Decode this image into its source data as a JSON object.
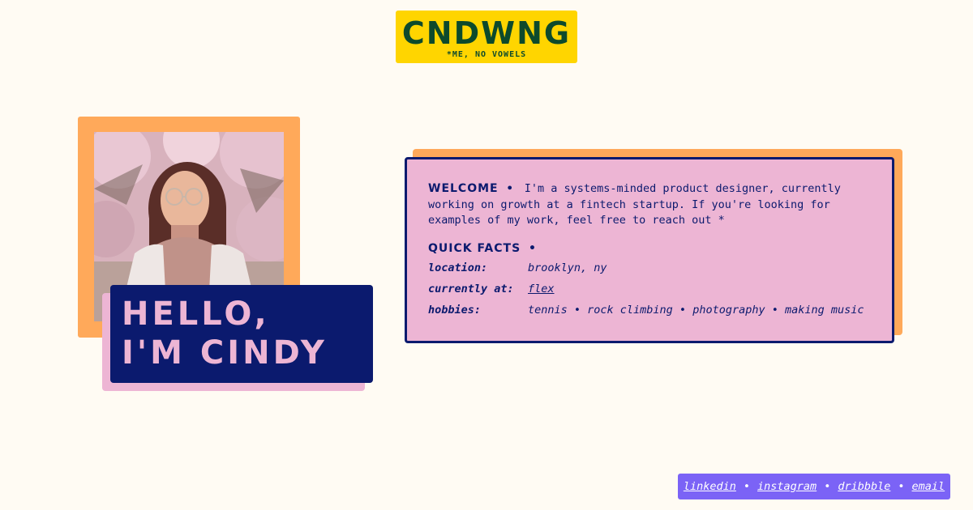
{
  "logo": {
    "title": "CNDWNG",
    "subtitle": "*ME, NO VOWELS"
  },
  "hero": {
    "line1": "HELLO,",
    "line2": "I'M CINDY"
  },
  "card": {
    "welcome_heading": "WELCOME",
    "bullet": "•",
    "intro": "I'm a systems-minded product designer, currently working on growth at a fintech startup. If you're looking for examples of my work, feel free to reach out *",
    "facts_heading": "QUICK FACTS",
    "facts": [
      {
        "label": "location:",
        "value": "brooklyn, ny"
      },
      {
        "label": "currently at:",
        "value": "flex"
      },
      {
        "label": "hobbies:",
        "value": "tennis • rock climbing • photography • making music"
      }
    ]
  },
  "footer": {
    "links": [
      "linkedin",
      "instagram",
      "dribbble",
      "email"
    ],
    "separator": "•"
  },
  "colors": {
    "background": "#fffbf3",
    "navy": "#0b1a6e",
    "pink": "#edb5d4",
    "orange": "#ffa95a",
    "yellow": "#ffd500",
    "green": "#0d4a2c",
    "purple": "#7b63f6"
  }
}
